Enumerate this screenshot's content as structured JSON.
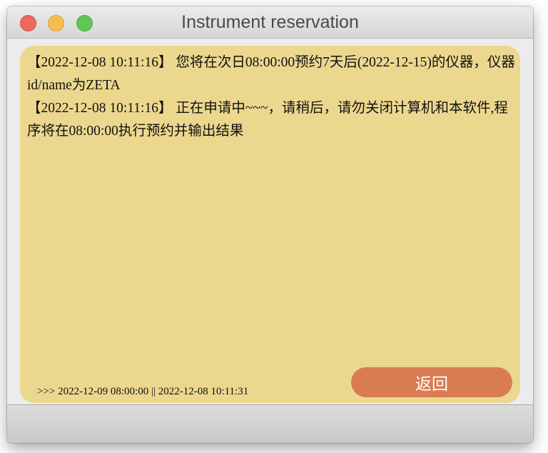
{
  "window": {
    "title": "Instrument reservation"
  },
  "log": {
    "lines": [
      "【2022-12-08 10:11:16】 您将在次日08:00:00预约7天后(2022-12-15)的仪器，仪器id/name为ZETA",
      "【2022-12-08 10:11:16】 正在申请中~~~，请稍后，请勿关闭计算机和本软件,程序将在08:00:00执行预约并输出结果"
    ]
  },
  "status": {
    "text": ">>> 2022-12-09 08:00:00 || 2022-12-08 10:11:31"
  },
  "buttons": {
    "back_label": "返回"
  },
  "colors": {
    "panel": "#ecd78e",
    "button": "#d97c52",
    "close": "#ee6a5e",
    "minimize": "#f5bf4f",
    "zoom": "#62c655"
  }
}
